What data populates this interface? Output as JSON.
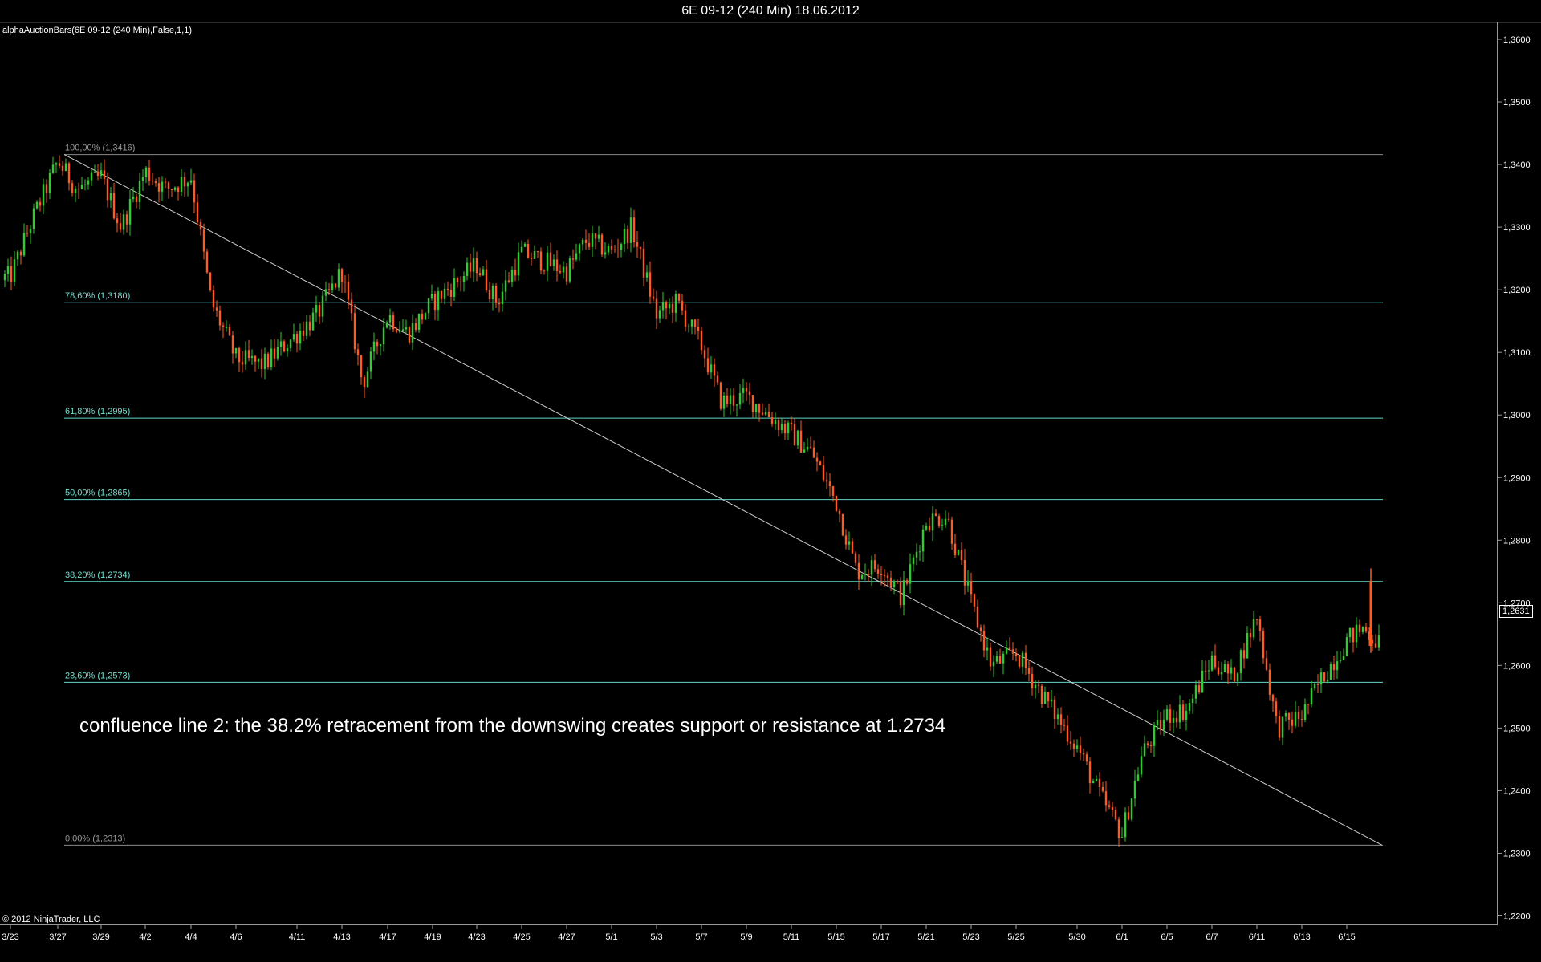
{
  "window": {
    "title": "6E 09-12 (240 Min)  18.06.2012",
    "indicator_label": "alphaAuctionBars(6E 09-12 (240 Min),False,1,1)",
    "copyright": "© 2012 NinjaTrader, LLC",
    "last_price": "1,2631",
    "annotation": "confluence line 2: the 38.2% retracement from the downswing creates support or resistance at 1.2734"
  },
  "colors": {
    "background": "#000000",
    "up_candle": "#2ecc2e",
    "down_candle": "#ff5a1f",
    "fib_line": "#5fd6c8",
    "fib_label": "#6fe0d0",
    "extreme_fib_label": "#9a9a9a",
    "trendline": "#cfcfcf"
  },
  "chart_data": {
    "type": "candlestick",
    "title": "6E 09-12 (240 Min)  18.06.2012",
    "ylim": [
      1.215,
      1.363
    ],
    "y_ticks": [
      {
        "value": 1.36,
        "label": "1,3600"
      },
      {
        "value": 1.35,
        "label": "1,3500"
      },
      {
        "value": 1.34,
        "label": "1,3400"
      },
      {
        "value": 1.33,
        "label": "1,3300"
      },
      {
        "value": 1.32,
        "label": "1,3200"
      },
      {
        "value": 1.31,
        "label": "1,3100"
      },
      {
        "value": 1.3,
        "label": "1,3000"
      },
      {
        "value": 1.29,
        "label": "1,2900"
      },
      {
        "value": 1.28,
        "label": "1,2800"
      },
      {
        "value": 1.27,
        "label": "1,2700"
      },
      {
        "value": 1.26,
        "label": "1,2600"
      },
      {
        "value": 1.25,
        "label": "1,2500"
      },
      {
        "value": 1.24,
        "label": "1,2400"
      },
      {
        "value": 1.23,
        "label": "1,2300"
      },
      {
        "value": 1.22,
        "label": "1,2200"
      }
    ],
    "x_ticks": [
      "3/23",
      "3/27",
      "3/29",
      "4/2",
      "4/4",
      "4/6",
      "4/11",
      "4/13",
      "4/17",
      "4/19",
      "4/23",
      "4/25",
      "4/27",
      "5/1",
      "5/3",
      "5/7",
      "5/9",
      "5/11",
      "5/15",
      "5/17",
      "5/21",
      "5/23",
      "5/25",
      "5/30",
      "6/1",
      "6/5",
      "6/7",
      "6/11",
      "6/13",
      "6/15"
    ],
    "fib_levels": [
      {
        "label": "100,00% (1,3416)",
        "value": 1.3416
      },
      {
        "label": "78,60% (1,3180)",
        "value": 1.318
      },
      {
        "label": "61,80% (1,2995)",
        "value": 1.2995
      },
      {
        "label": "50,00% (1,2865)",
        "value": 1.2865
      },
      {
        "label": "38,20% (1,2734)",
        "value": 1.2734
      },
      {
        "label": "23,60% (1,2573)",
        "value": 1.2573
      },
      {
        "label": "0,00% (1,2313)",
        "value": 1.2313
      }
    ],
    "trendline": {
      "from": {
        "x": "3/27",
        "y": 1.3416
      },
      "to": {
        "x": "6/18",
        "y": 1.2313
      }
    },
    "path_anchors": [
      {
        "x": "3/23",
        "close": 1.322
      },
      {
        "x": "3/23",
        "close": 1.331
      },
      {
        "x": "3/27",
        "close": 1.3405
      },
      {
        "x": "3/27",
        "close": 1.336
      },
      {
        "x": "3/29",
        "close": 1.338
      },
      {
        "x": "3/29",
        "close": 1.33
      },
      {
        "x": "4/2",
        "close": 1.339
      },
      {
        "x": "4/2",
        "close": 1.336
      },
      {
        "x": "4/4",
        "close": 1.338
      },
      {
        "x": "4/4",
        "close": 1.318
      },
      {
        "x": "4/6",
        "close": 1.309
      },
      {
        "x": "4/6",
        "close": 1.308
      },
      {
        "x": "4/11",
        "close": 1.313
      },
      {
        "x": "4/11",
        "close": 1.316
      },
      {
        "x": "4/13",
        "close": 1.323
      },
      {
        "x": "4/13",
        "close": 1.305
      },
      {
        "x": "4/17",
        "close": 1.316
      },
      {
        "x": "4/17",
        "close": 1.313
      },
      {
        "x": "4/19",
        "close": 1.318
      },
      {
        "x": "4/23",
        "close": 1.324
      },
      {
        "x": "4/23",
        "close": 1.318
      },
      {
        "x": "4/25",
        "close": 1.326
      },
      {
        "x": "4/27",
        "close": 1.323
      },
      {
        "x": "4/27",
        "close": 1.328
      },
      {
        "x": "5/1",
        "close": 1.326
      },
      {
        "x": "5/1",
        "close": 1.33
      },
      {
        "x": "5/3",
        "close": 1.316
      },
      {
        "x": "5/3",
        "close": 1.318
      },
      {
        "x": "5/7",
        "close": 1.311
      },
      {
        "x": "5/7",
        "close": 1.302
      },
      {
        "x": "5/9",
        "close": 1.303
      },
      {
        "x": "5/11",
        "close": 1.297
      },
      {
        "x": "5/11",
        "close": 1.294
      },
      {
        "x": "5/15",
        "close": 1.286
      },
      {
        "x": "5/15",
        "close": 1.275
      },
      {
        "x": "5/17",
        "close": 1.276
      },
      {
        "x": "5/17",
        "close": 1.271
      },
      {
        "x": "5/21",
        "close": 1.283
      },
      {
        "x": "5/21",
        "close": 1.284
      },
      {
        "x": "5/23",
        "close": 1.27
      },
      {
        "x": "5/23",
        "close": 1.26
      },
      {
        "x": "5/25",
        "close": 1.262
      },
      {
        "x": "5/25",
        "close": 1.255
      },
      {
        "x": "5/30",
        "close": 1.247
      },
      {
        "x": "5/30",
        "close": 1.24
      },
      {
        "x": "6/1",
        "close": 1.233
      },
      {
        "x": "6/1",
        "close": 1.246
      },
      {
        "x": "6/5",
        "close": 1.252
      },
      {
        "x": "6/5",
        "close": 1.253
      },
      {
        "x": "6/7",
        "close": 1.261
      },
      {
        "x": "6/7",
        "close": 1.258
      },
      {
        "x": "6/11",
        "close": 1.268
      },
      {
        "x": "6/11",
        "close": 1.25
      },
      {
        "x": "6/13",
        "close": 1.252
      },
      {
        "x": "6/13",
        "close": 1.258
      },
      {
        "x": "6/15",
        "close": 1.264
      },
      {
        "x": "6/15",
        "close": 1.266
      },
      {
        "x": "6/18",
        "close": 1.2631
      }
    ]
  }
}
